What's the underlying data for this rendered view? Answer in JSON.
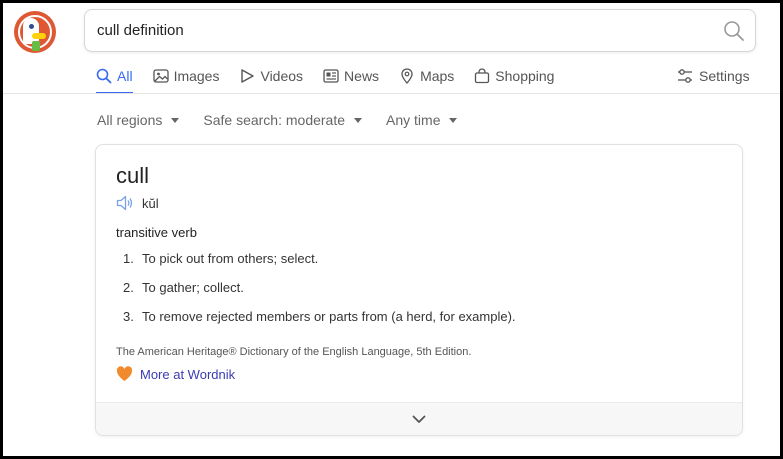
{
  "search": {
    "query": "cull definition"
  },
  "nav": {
    "tabs": [
      {
        "label": "All",
        "icon": "search-icon",
        "active": true
      },
      {
        "label": "Images",
        "icon": "image-icon"
      },
      {
        "label": "Videos",
        "icon": "play-icon"
      },
      {
        "label": "News",
        "icon": "newspaper-icon"
      },
      {
        "label": "Maps",
        "icon": "map-pin-icon"
      },
      {
        "label": "Shopping",
        "icon": "shopping-bag-icon"
      }
    ],
    "settings_label": "Settings"
  },
  "filters": {
    "region": "All regions",
    "safe_search": "Safe search: moderate",
    "time": "Any time"
  },
  "definition": {
    "word": "cull",
    "pronunciation": "kŭl",
    "part_of_speech": "transitive verb",
    "senses": [
      {
        "num": "1.",
        "text": "To pick out from others; select."
      },
      {
        "num": "2.",
        "text": "To gather; collect."
      },
      {
        "num": "3.",
        "text": "To remove rejected members or parts from (a herd, for example)."
      }
    ],
    "source": "The American Heritage® Dictionary of the English Language, 5th Edition.",
    "more_link": "More at Wordnik"
  },
  "colors": {
    "accent": "#3969ef",
    "brand": "#de5833",
    "link": "#3b3bb3"
  }
}
